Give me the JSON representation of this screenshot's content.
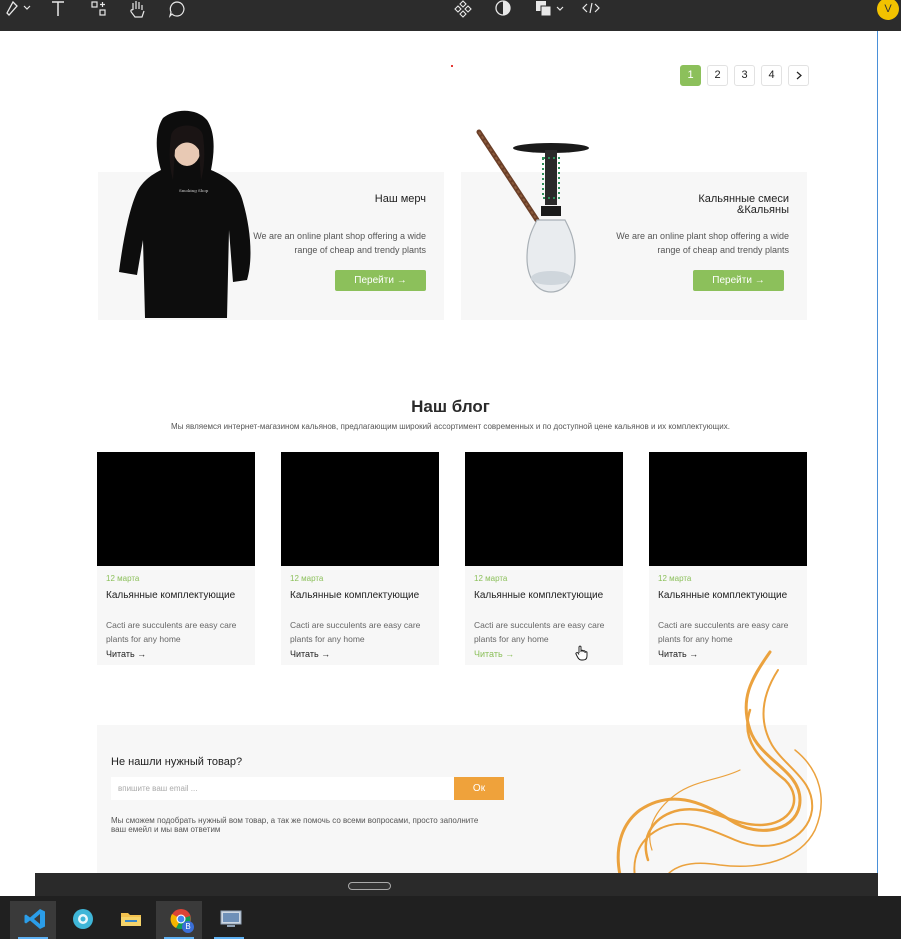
{
  "toolbar": {
    "icons": [
      "pen-icon",
      "text-icon",
      "shapes-icon",
      "hand-icon",
      "comment-icon",
      "components-icon",
      "contrast-icon",
      "boolean-icon",
      "code-icon"
    ],
    "avatar_letter": "V"
  },
  "pagination": {
    "pages": [
      "1",
      "2",
      "3",
      "4"
    ],
    "active": "1",
    "next": ">"
  },
  "promos": [
    {
      "title": "Наш мерч",
      "desc": "We are an online plant shop offering a wide range of cheap and trendy plants",
      "button": "Перейти →"
    },
    {
      "title": "Кальянные смеси &Кальяны",
      "desc": "We are an online plant shop offering a wide range of cheap and trendy plants",
      "button": "Перейти →"
    }
  ],
  "blog": {
    "title": "Наш блог",
    "subtitle": "Мы являемся интернет-магазином кальянов, предлагающим широкий ассортимент современных и по доступной цене кальянов и их комплектующих.",
    "cards": [
      {
        "date": "12 марта",
        "title": "Кальянные комплектующие",
        "desc": "Cacti are succulents are easy care plants for any home",
        "read": "Читать →"
      },
      {
        "date": "12 марта",
        "title": "Кальянные комплектующие",
        "desc": "Cacti are succulents are easy care plants for any home",
        "read": "Читать →"
      },
      {
        "date": "12 марта",
        "title": "Кальянные комплектующие",
        "desc": "Cacti are succulents are easy care plants for any home",
        "read": "Читать →"
      },
      {
        "date": "12 марта",
        "title": "Кальянные комплектующие",
        "desc": "Cacti are succulents are easy care plants for any home",
        "read": "Читать →"
      }
    ]
  },
  "newsletter": {
    "title": "Не нашли нужный товар?",
    "placeholder": "впишите ваш email ...",
    "button": "Ок",
    "text": "Мы сможем подобрать нужный вом товар, а так же помочь со всеми вопросами, просто заполните ваш емейл и мы вам ответим"
  },
  "taskbar": {
    "apps": [
      "vscode-icon",
      "app-icon",
      "file-explorer-icon",
      "chrome-icon",
      "monitor-app-icon"
    ],
    "chrome_badge": "B"
  },
  "colors": {
    "accent_green": "#8cc05b",
    "accent_orange": "#efa23b",
    "toolbar_bg": "#2c2c2c",
    "card_bg": "#f7f7f7"
  }
}
